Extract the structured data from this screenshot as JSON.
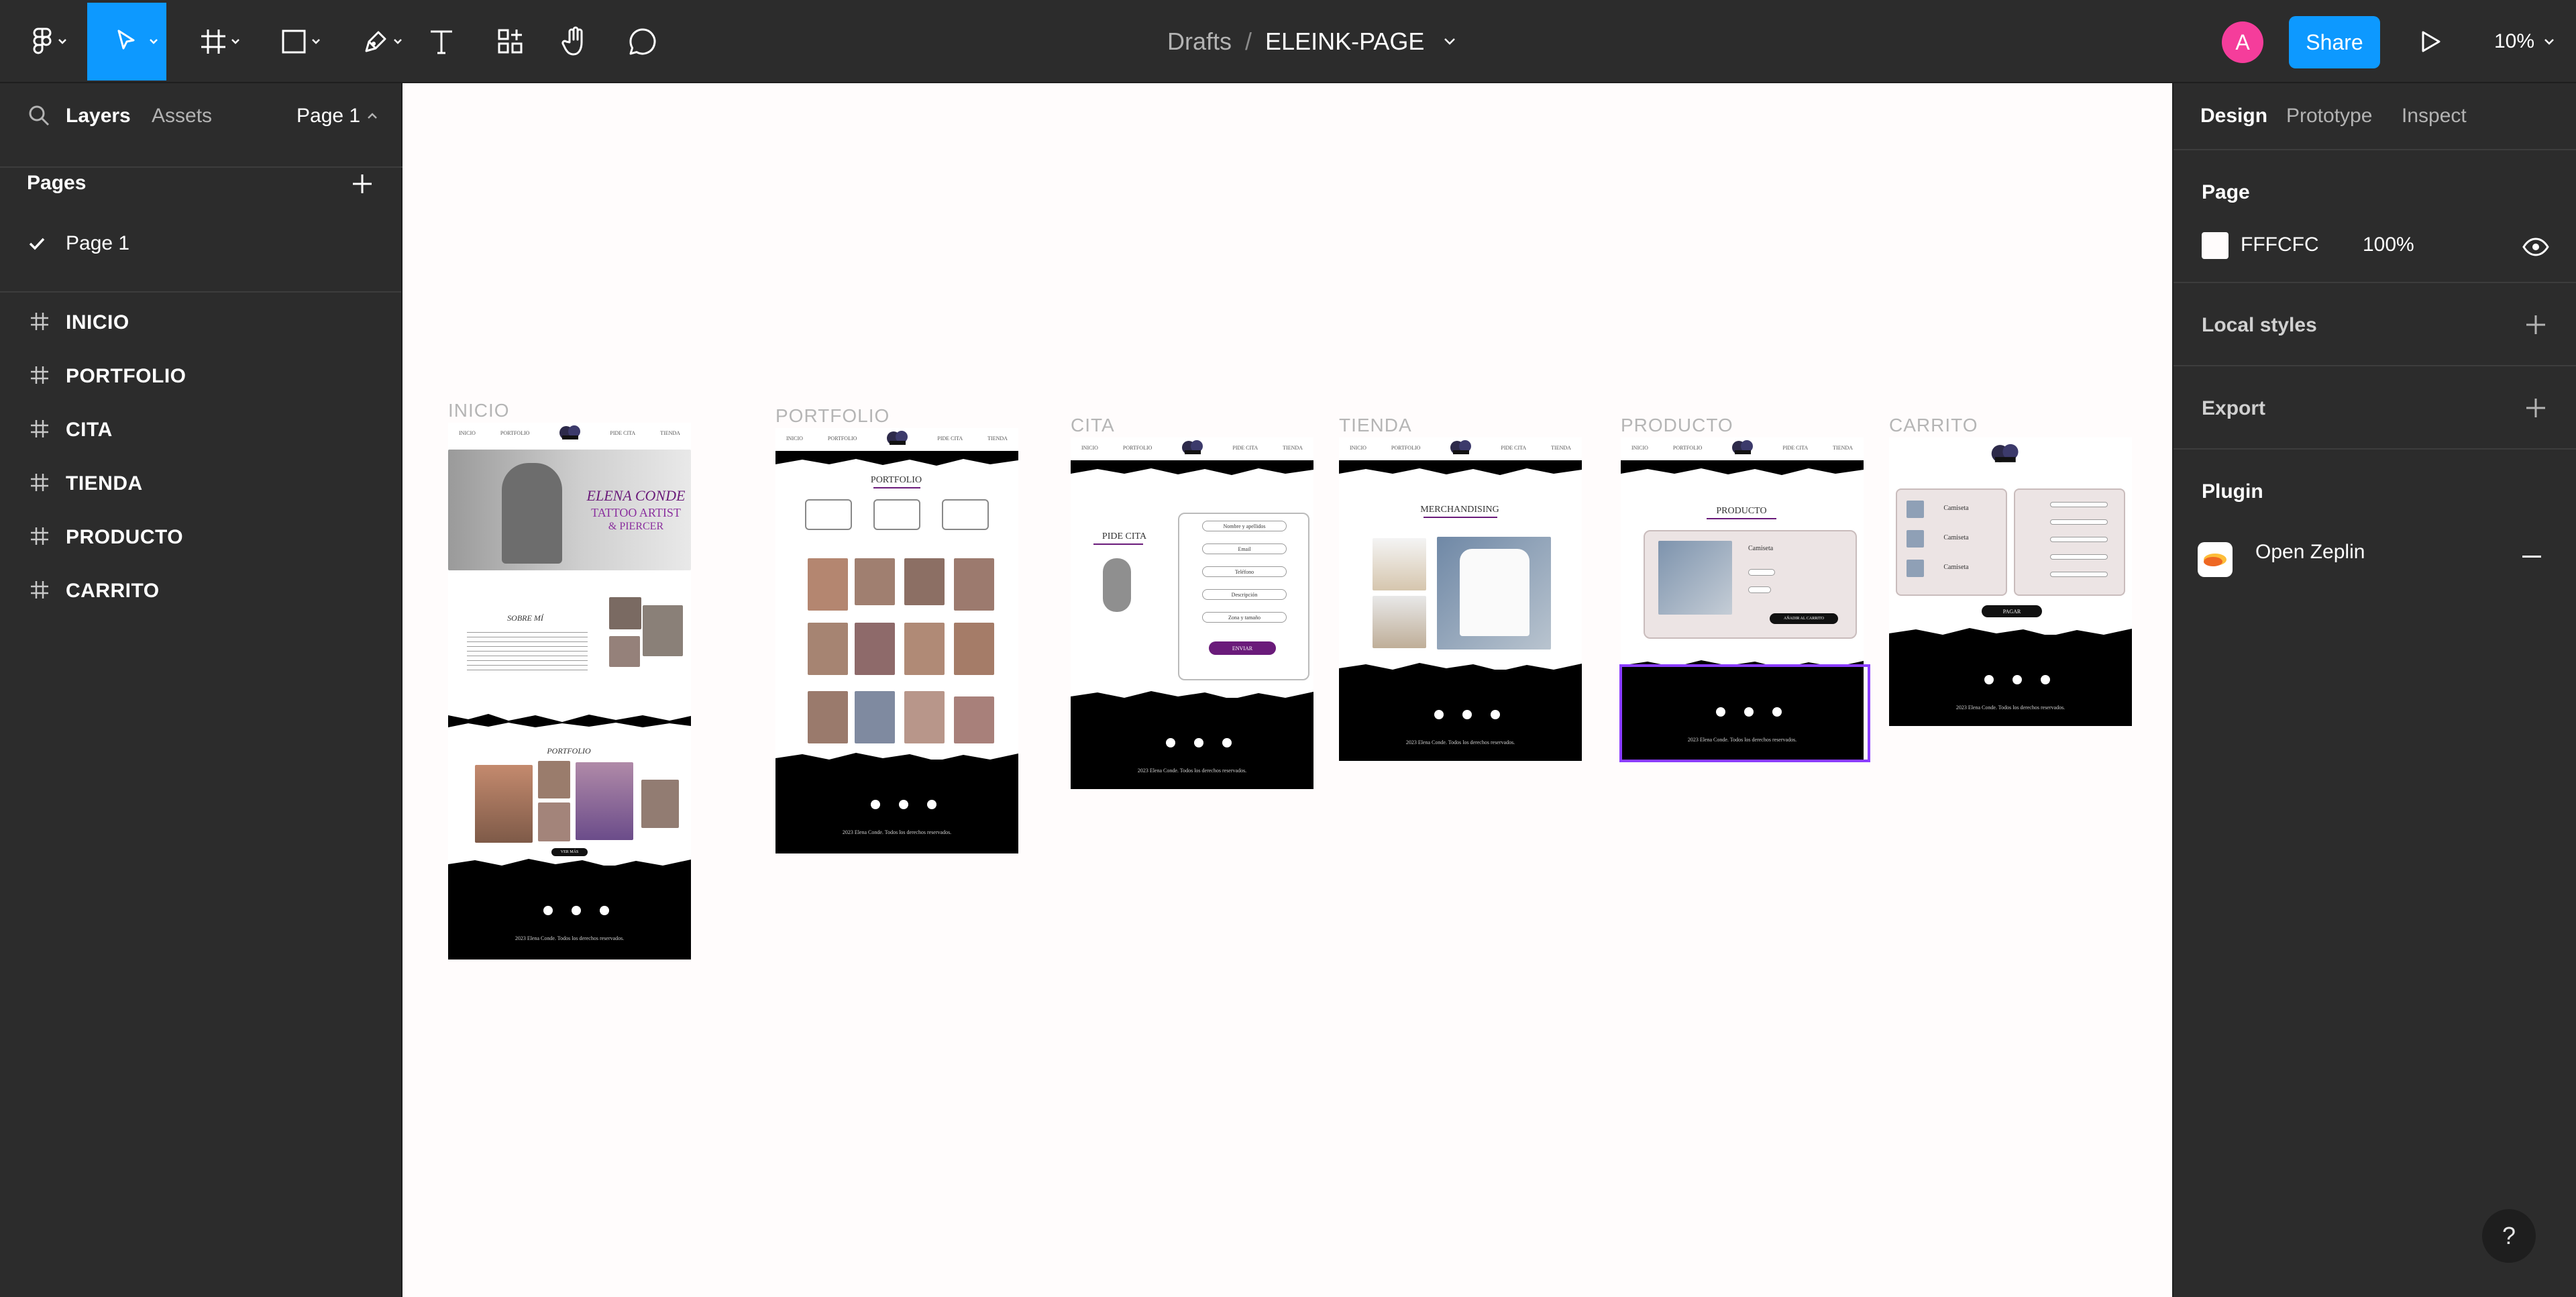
{
  "toolbar": {
    "breadcrumb_drafts": "Drafts",
    "breadcrumb_sep": "/",
    "file_name": "ELEINK-PAGE",
    "avatar_initial": "A",
    "share_label": "Share",
    "zoom": "10%"
  },
  "left_panel": {
    "tab_layers": "Layers",
    "tab_assets": "Assets",
    "page_switcher": "Page 1",
    "pages_title": "Pages",
    "pages": [
      {
        "label": "Page 1",
        "selected": true
      }
    ],
    "layers": [
      {
        "label": "INICIO"
      },
      {
        "label": "PORTFOLIO"
      },
      {
        "label": "CITA"
      },
      {
        "label": "TIENDA"
      },
      {
        "label": "PRODUCTO"
      },
      {
        "label": "CARRITO"
      }
    ]
  },
  "right_panel": {
    "tabs": [
      "Design",
      "Prototype",
      "Inspect"
    ],
    "page_section": "Page",
    "bg_hex": "FFFCFC",
    "bg_opacity": "100%",
    "local_styles": "Local styles",
    "export": "Export",
    "plugin_section": "Plugin",
    "plugin_name": "Open Zeplin"
  },
  "canvas": {
    "background": "#FFFCFC",
    "frames": [
      {
        "label": "INICIO"
      },
      {
        "label": "PORTFOLIO"
      },
      {
        "label": "CITA"
      },
      {
        "label": "TIENDA"
      },
      {
        "label": "PRODUCTO"
      },
      {
        "label": "CARRITO"
      }
    ],
    "mock": {
      "nav": [
        "INICIO",
        "PORTFOLIO",
        "PIDE CITA",
        "TIENDA"
      ],
      "hero_name": "ELENA CONDE",
      "hero_sub1": "TATTOO ARTIST",
      "hero_sub2": "& PIERCER",
      "sobre_mi": "SOBRE MÍ",
      "portfolio_heading": "PORTFOLIO",
      "ver_mas": "VER MÁS",
      "pide_cita": "PIDE CITA",
      "form_fields": [
        "Nombre y apellidos",
        "Email",
        "Teléfono",
        "Descripción",
        "Zona y tamaño"
      ],
      "enviar": "ENVIAR",
      "merch": "MERCHANDISING",
      "producto": "PRODUCTO",
      "camiseta": "Camiseta",
      "add_cart": "AÑADIR AL CARRITO",
      "pagar": "PAGAR",
      "copyright": "2023 Elena Conde. Todos los derechos reservados."
    }
  },
  "colors": {
    "accent": "#0d99ff",
    "avatar": "#f53d9b",
    "selection": "#8b3dff",
    "brand_purple": "#6a1b7a"
  }
}
